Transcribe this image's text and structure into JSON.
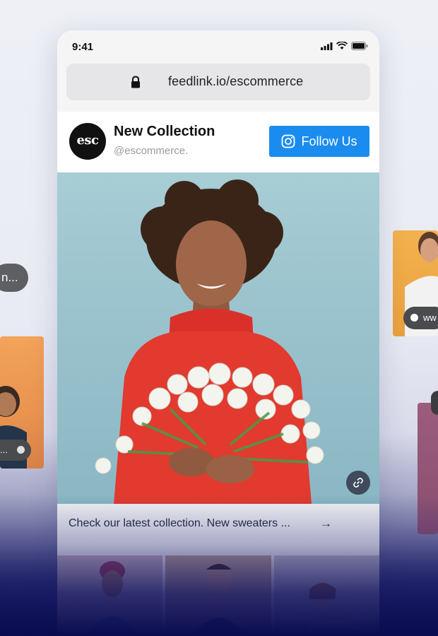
{
  "side": {
    "left_pill_text": "n...",
    "left_dot_pill_text": "...",
    "right_pill_text": "ww"
  },
  "phone": {
    "status": {
      "time": "9:41"
    },
    "browser": {
      "url": "feedlink.io/escommerce"
    },
    "profile": {
      "avatar_text": "esc",
      "title": "New Collection",
      "handle": "@escommerce.",
      "follow_label": "Follow Us"
    },
    "post": {
      "caption": "Check our latest collection. New sweaters ...",
      "arrow": "→"
    }
  },
  "colors": {
    "follow_button": "#1a8cf0",
    "page_bg": "#eef0f6",
    "bottom_fade": "#0f1258"
  },
  "icons": [
    "lock-icon",
    "signal-icon",
    "wifi-icon",
    "battery-icon",
    "instagram-icon",
    "link-icon",
    "arrow-right-icon"
  ]
}
